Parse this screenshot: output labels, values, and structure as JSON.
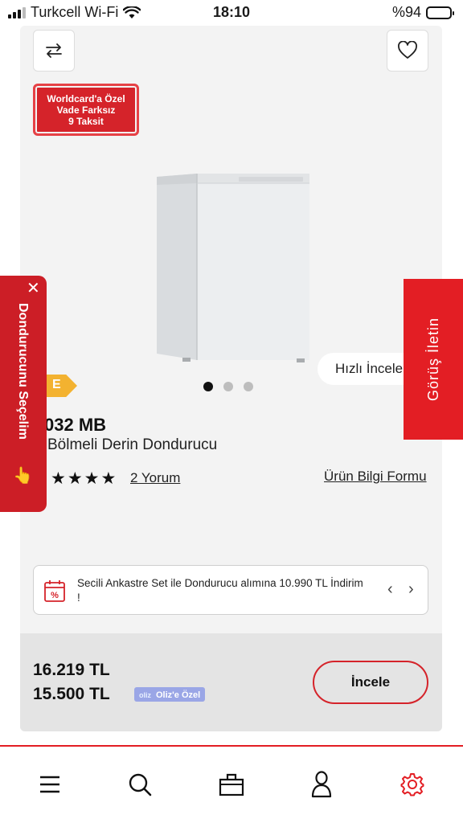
{
  "status_bar": {
    "carrier": "Turkcell Wi-Fi",
    "time": "18:10",
    "battery": "%94"
  },
  "product": {
    "promo_badge": [
      "Worldcard'a Özel",
      "Vade Farksız",
      "9 Taksit"
    ],
    "quick_view_label": "Hızlı İncele",
    "carousel": {
      "count": 3,
      "active_index": 0
    },
    "energy_class": "E",
    "model": "032 MB",
    "name": "Bölmeli Derin Dondurucu",
    "rating_stars": "★★★★",
    "reviews_label": "2 Yorum",
    "info_form_label": "Ürün Bilgi Formu"
  },
  "campaign": {
    "text": "Secili Ankastre Set ile Dondurucu alımına 10.990 TL İndirim !",
    "prev": "‹",
    "next": "›"
  },
  "pricing": {
    "old_price": "16.219 TL",
    "new_price": "15.500 TL",
    "oliz_logo": "oliz",
    "oliz_label": "Oliz'e Özel",
    "inspect_label": "İncele"
  },
  "side_tabs": {
    "left_label": "Dondurucunu Seçelim",
    "left_close": "✕",
    "left_hand": "👆",
    "right_label": "Görüş İletin"
  },
  "nav": {
    "items": [
      "menu-icon",
      "search-icon",
      "bag-icon",
      "user-icon",
      "settings-icon"
    ]
  },
  "colors": {
    "brand_red": "#e31e24",
    "energy_e": "#f3b230",
    "oliz": "#9aa6e6"
  }
}
